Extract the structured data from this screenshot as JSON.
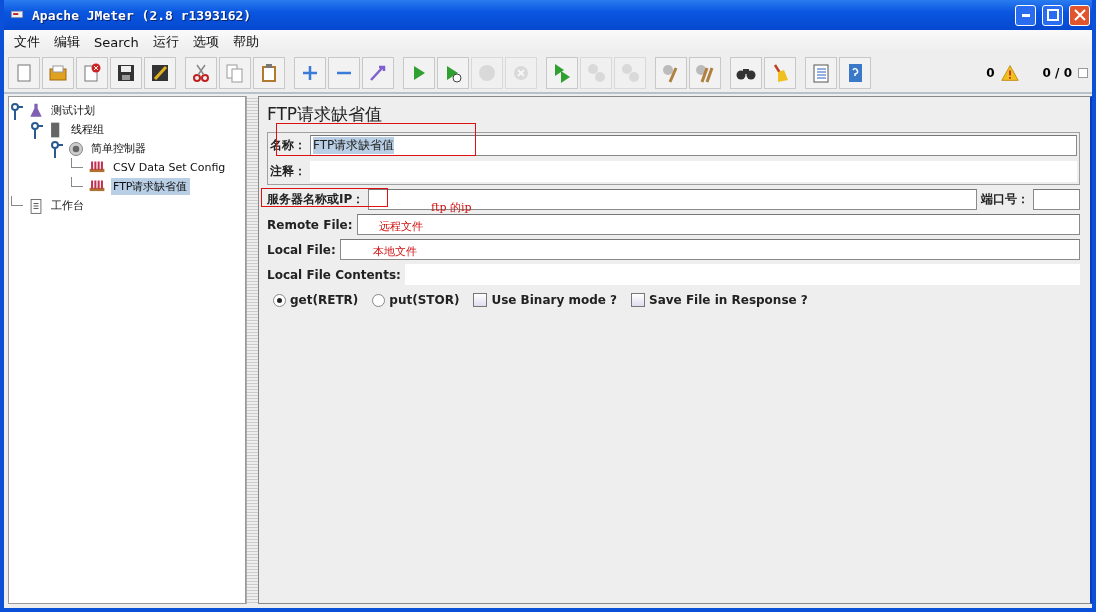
{
  "window": {
    "title": "Apache JMeter (2.8 r1393162)"
  },
  "menu": [
    "文件",
    "编辑",
    "Search",
    "运行",
    "选项",
    "帮助"
  ],
  "toolbar": [
    [
      {
        "kind": "new",
        "disabled": false
      },
      {
        "kind": "open",
        "disabled": false
      },
      {
        "kind": "close",
        "disabled": false
      },
      {
        "kind": "save",
        "disabled": false
      },
      {
        "kind": "save-as",
        "disabled": false
      }
    ],
    [
      {
        "kind": "cut",
        "disabled": false
      },
      {
        "kind": "copy",
        "disabled": false
      },
      {
        "kind": "paste",
        "disabled": false
      }
    ],
    [
      {
        "kind": "add",
        "disabled": false
      },
      {
        "kind": "remove",
        "disabled": false
      },
      {
        "kind": "toggle",
        "disabled": false
      }
    ],
    [
      {
        "kind": "start",
        "disabled": false
      },
      {
        "kind": "start-no-timers",
        "disabled": false
      },
      {
        "kind": "stop",
        "disabled": true
      },
      {
        "kind": "shutdown",
        "disabled": true
      }
    ],
    [
      {
        "kind": "remote-start",
        "disabled": false
      },
      {
        "kind": "remote-stop",
        "disabled": true
      },
      {
        "kind": "remote-shutdown",
        "disabled": true
      }
    ],
    [
      {
        "kind": "clear",
        "disabled": false
      },
      {
        "kind": "clear-all",
        "disabled": false
      }
    ],
    [
      {
        "kind": "search",
        "disabled": false
      },
      {
        "kind": "reset",
        "disabled": false
      }
    ],
    [
      {
        "kind": "functions",
        "disabled": false
      },
      {
        "kind": "help",
        "disabled": false
      }
    ]
  ],
  "status": {
    "errors": "0",
    "threads": "0 / 0"
  },
  "tree": [
    {
      "label": "测试计划",
      "kind": "plan",
      "selected": false,
      "children": [
        {
          "label": "线程组",
          "kind": "threads",
          "selected": false,
          "children": [
            {
              "label": "简单控制器",
              "kind": "controller",
              "selected": false,
              "children": [
                {
                  "label": "CSV Data Set Config",
                  "kind": "config",
                  "selected": false
                },
                {
                  "label": "FTP请求缺省值",
                  "kind": "config",
                  "selected": true
                }
              ]
            }
          ]
        }
      ]
    },
    {
      "label": "工作台",
      "kind": "workbench",
      "selected": false
    }
  ],
  "panel": {
    "title": "FTP请求缺省值",
    "name": {
      "label": "名称：",
      "value": "FTP请求缺省值",
      "marked": true
    },
    "comments": {
      "label": "注释："
    },
    "server": {
      "label": "服务器名称或IP：",
      "marked": true,
      "note": "ftp 的ip"
    },
    "port": {
      "label": "端口号："
    },
    "files": [
      {
        "label": "Remote File:",
        "note": "远程文件",
        "kind": "bordered"
      },
      {
        "label": "Local File:",
        "note": "本地文件",
        "kind": "bordered"
      },
      {
        "label": "Local File Contents:",
        "kind": "flat"
      }
    ],
    "options": [
      {
        "kind": "radio",
        "label": "get(RETR)",
        "selected": true
      },
      {
        "kind": "radio",
        "label": "put(STOR)",
        "selected": false
      },
      {
        "kind": "checkbox",
        "label": "Use Binary mode ?",
        "checked": false
      },
      {
        "kind": "checkbox",
        "label": "Save File in Response ?",
        "checked": false
      }
    ]
  }
}
